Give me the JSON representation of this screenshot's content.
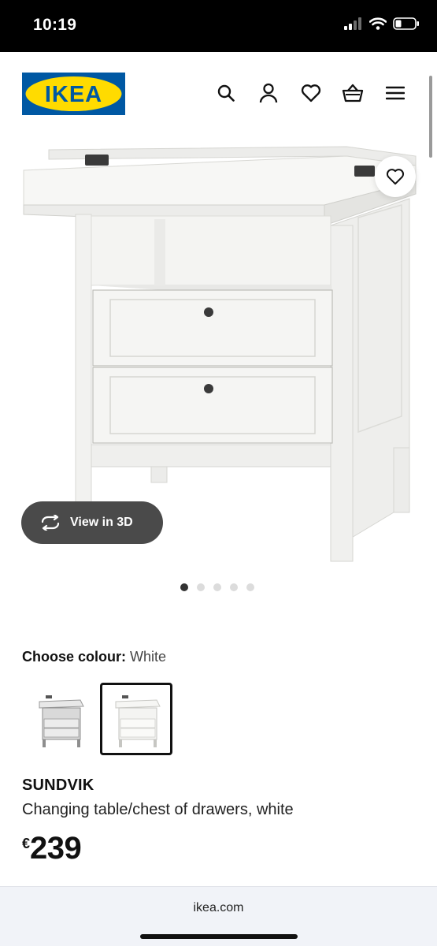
{
  "status_bar": {
    "time": "10:19"
  },
  "header": {
    "logo_text": "IKEA",
    "brand_colors": {
      "blue": "#0058A3",
      "yellow": "#FFDB00"
    },
    "icons": [
      "search-icon",
      "user-icon",
      "heart-icon",
      "basket-icon",
      "menu-icon"
    ]
  },
  "gallery": {
    "view3d_label": "View in 3D",
    "image_count": 5,
    "active_index": 0
  },
  "colour": {
    "label": "Choose colour:",
    "value": "White",
    "options_count": 2,
    "selected_index": 1
  },
  "product": {
    "name": "SUNDVIK",
    "description": "Changing table/chest of drawers, white",
    "currency": "€",
    "price": "239"
  },
  "browser": {
    "url": "ikea.com"
  }
}
